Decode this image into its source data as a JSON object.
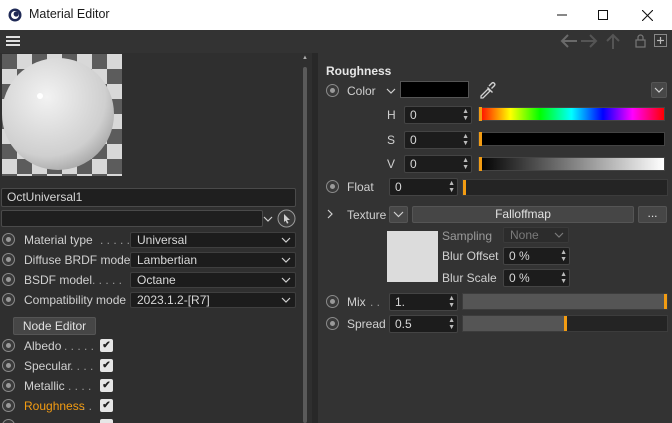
{
  "window": {
    "title": "Material Editor"
  },
  "preview": {
    "material_name": "OctUniversal1",
    "secondary_field": ""
  },
  "params": [
    {
      "label": "Material type",
      "dots": ". . . . .",
      "value": "Universal"
    },
    {
      "label": "Diffuse BRDF model",
      "dots": "",
      "value": "Lambertian"
    },
    {
      "label": "BSDF model",
      "dots": ". . . . .",
      "value": "Octane"
    },
    {
      "label": "Compatibility mode",
      "dots": "",
      "value": "2023.1.2-[R7]"
    }
  ],
  "node_editor_label": "Node Editor",
  "channels": [
    {
      "label": "Albedo",
      "dots": ". . . . .",
      "checked": true,
      "active": false
    },
    {
      "label": "Specular",
      "dots": ". . . .",
      "checked": true,
      "active": false
    },
    {
      "label": "Metallic",
      "dots": ". . . .",
      "checked": true,
      "active": false
    },
    {
      "label": "Roughness",
      "dots": ". .",
      "checked": true,
      "active": true
    }
  ],
  "section": {
    "title": "Roughness"
  },
  "color": {
    "label": "Color",
    "swatch": "#000000",
    "h_label": "H",
    "h_value": "0",
    "s_label": "S",
    "s_value": "0",
    "v_label": "V",
    "v_value": "0"
  },
  "float": {
    "label": "Float",
    "value": "0"
  },
  "texture": {
    "label": "Texture",
    "shader": "Falloffmap",
    "more": "...",
    "sampling_label": "Sampling",
    "sampling_value": "None",
    "blur_offset_label": "Blur Offset",
    "blur_offset_value": "0 %",
    "blur_scale_label": "Blur Scale",
    "blur_scale_value": "0 %"
  },
  "mix": {
    "label": "Mix",
    "dots": ". .",
    "value": "1.",
    "level": 1.0
  },
  "spread": {
    "label": "Spread",
    "value": "0.5",
    "level": 0.5
  },
  "accent": "#f39c12"
}
